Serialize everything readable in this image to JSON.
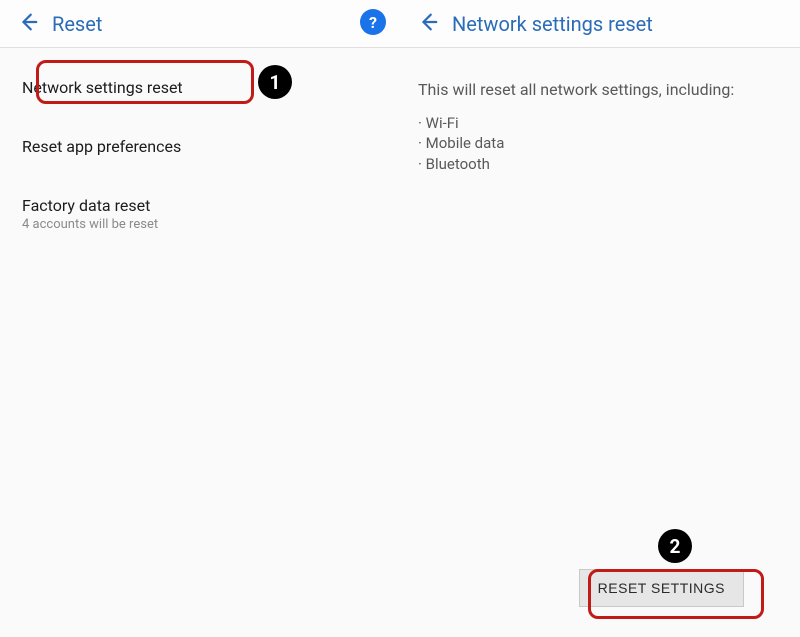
{
  "left": {
    "title": "Reset",
    "items": [
      {
        "primary": "Network settings reset",
        "secondary": null
      },
      {
        "primary": "Reset app preferences",
        "secondary": null
      },
      {
        "primary": "Factory data reset",
        "secondary": "4 accounts will be reset"
      }
    ],
    "help_icon": "?"
  },
  "right": {
    "title": "Network settings reset",
    "intro": "This will reset all network settings, including:",
    "bullets": [
      "Wi-Fi",
      "Mobile data",
      "Bluetooth"
    ],
    "button": "RESET SETTINGS"
  },
  "annotations": {
    "callout1": "1",
    "callout2": "2"
  }
}
